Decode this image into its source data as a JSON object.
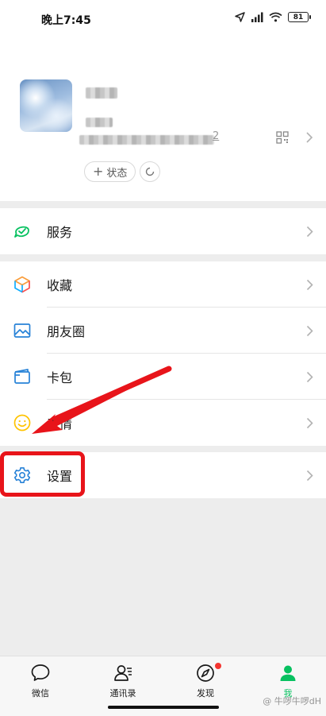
{
  "status_bar": {
    "time": "晚上7:45",
    "battery": "81"
  },
  "profile": {
    "id_suffix": "2",
    "status_button": "状态"
  },
  "menu": {
    "service": "服务",
    "favorites": "收藏",
    "moments": "朋友圈",
    "cards": "卡包",
    "stickers": "表情",
    "settings": "设置"
  },
  "tabbar": {
    "chats": "微信",
    "contacts": "通讯录",
    "discover": "发现",
    "me": "我"
  },
  "watermark": "@ 牛啰牛啰dH",
  "colors": {
    "accent": "#07c160",
    "highlight": "#e8141a",
    "badge": "#f43530"
  }
}
